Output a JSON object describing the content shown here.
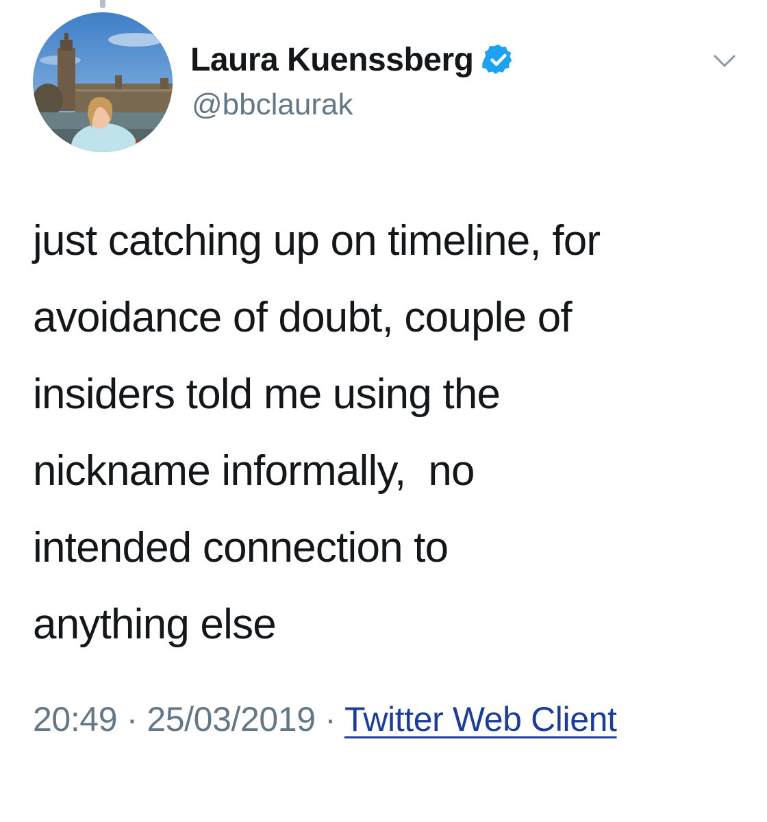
{
  "tweet": {
    "author": {
      "display_name": "Laura Kuenssberg",
      "handle": "@bbclaurak",
      "verified": true,
      "verified_color": "#1da1f2"
    },
    "text": "just catching up on timeline, for\navoidance of doubt, couple of\ninsiders told me using the\nnickname informally,  no\nintended connection to\nanything else",
    "time": "20:49",
    "separator": " · ",
    "date": "25/03/2019",
    "source_link": "Twitter Web Client",
    "icons": {
      "menu": "chevron-down-icon",
      "verified": "verified-badge-icon"
    }
  },
  "colors": {
    "text_primary": "#14171a",
    "text_secondary": "#657786",
    "link": "#1b3d9a"
  }
}
